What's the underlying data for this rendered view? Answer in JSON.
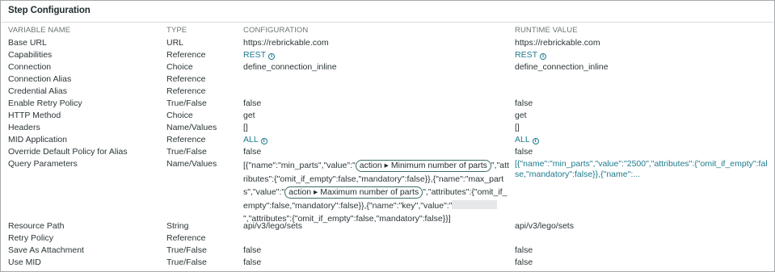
{
  "panel": {
    "title": "Step Configuration"
  },
  "columns": {
    "name": "VARIABLE NAME",
    "type": "TYPE",
    "configuration": "CONFIGURATION",
    "runtime": "RUNTIME VALUE"
  },
  "rows": [
    {
      "name": "Base URL",
      "type": "URL",
      "config": "https://rebrickable.com",
      "runtime": "https://rebrickable.com"
    },
    {
      "name": "Capabilities",
      "type": "Reference",
      "config": "REST",
      "runtime": "REST"
    },
    {
      "name": "Connection",
      "type": "Choice",
      "config": "define_connection_inline",
      "runtime": "define_connection_inline"
    },
    {
      "name": "Connection Alias",
      "type": "Reference",
      "config": "",
      "runtime": ""
    },
    {
      "name": "Credential Alias",
      "type": "Reference",
      "config": "",
      "runtime": ""
    },
    {
      "name": "Enable Retry Policy",
      "type": "True/False",
      "config": "false",
      "runtime": "false"
    },
    {
      "name": "HTTP Method",
      "type": "Choice",
      "config": "get",
      "runtime": "get"
    },
    {
      "name": "Headers",
      "type": "Name/Values",
      "config": "[]",
      "runtime": "[]"
    },
    {
      "name": "MID Application",
      "type": "Reference",
      "config": "ALL",
      "runtime": "ALL"
    },
    {
      "name": "Override Default Policy for Alias",
      "type": "True/False",
      "config": "false",
      "runtime": "false"
    },
    {
      "name": "Query Parameters",
      "type": "Name/Values",
      "config": "",
      "runtime": ""
    },
    {
      "name": "Resource Path",
      "type": "String",
      "config": "api/v3/lego/sets",
      "runtime": "api/v3/lego/sets"
    },
    {
      "name": "Retry Policy",
      "type": "Reference",
      "config": "",
      "runtime": ""
    },
    {
      "name": "Save As Attachment",
      "type": "True/False",
      "config": "false",
      "runtime": "false"
    },
    {
      "name": "Use MID",
      "type": "True/False",
      "config": "false",
      "runtime": "false"
    }
  ],
  "query_parameters": {
    "config_parts": [
      "[{\"name\":\"min_parts\",\"value\":\"",
      "action ▸ Minimum number of parts",
      "\",\"attributes\":{\"omit_if_empty\":false,\"mandatory\":false}},{\"name\":\"max_parts\",\"value\":\"",
      "action ▸ Maximum number of parts",
      "\",\"attributes\":{\"omit_if_empty\":false,\"mandatory\":false}},{\"name\":\"key\",\"value\":\"",
      "\",\"attributes\":{\"omit_if_empty\":false,\"mandatory\":false}}]"
    ],
    "runtime": "[{\"name\":\"min_parts\",\"value\":\"2500\",\"attributes\":{\"omit_if_empty\":false,\"mandatory\":false}},{\"name\":..."
  },
  "icons": {
    "info": "info-circle-icon"
  },
  "colors": {
    "link": "#1d7a8c",
    "pill_border": "#3a6e6a"
  }
}
